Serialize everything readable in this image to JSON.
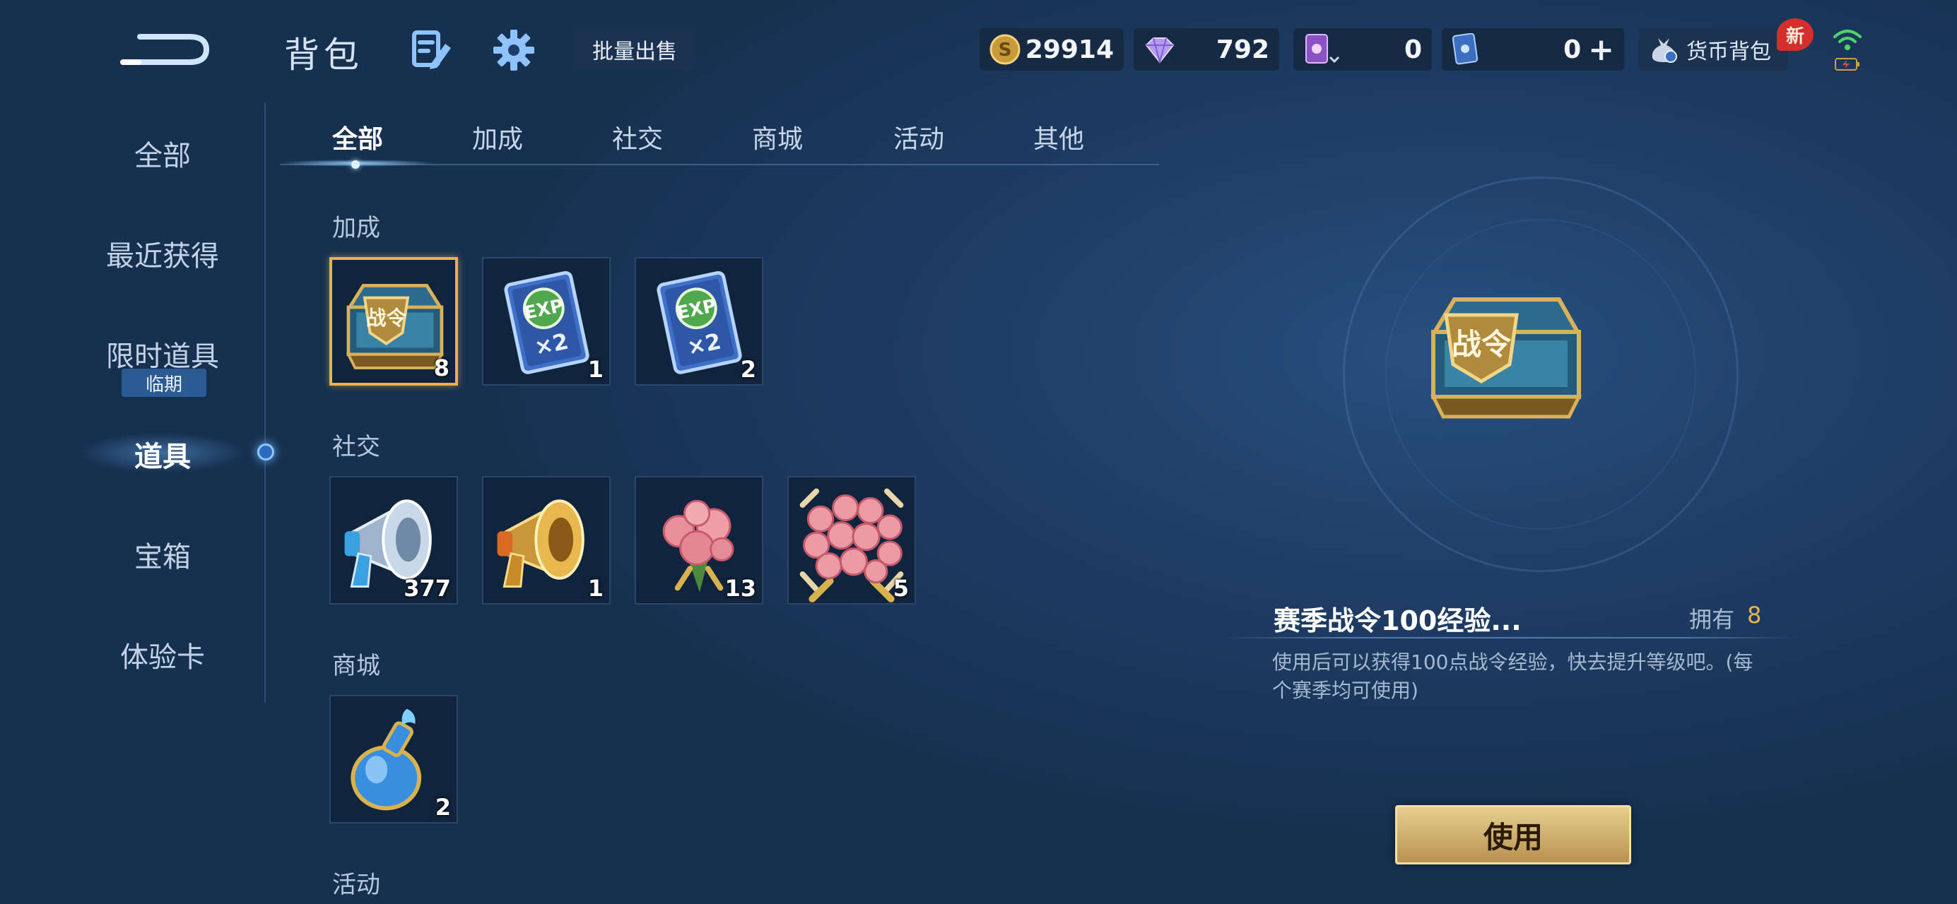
{
  "header": {
    "title": "背包",
    "bulk_sell_label": "批量出售",
    "wallet_label": "货币背包",
    "new_badge": "新"
  },
  "currencies": {
    "gold": "29914",
    "diamond": "792",
    "ticket": "0",
    "card": "0"
  },
  "sidebar": {
    "items": [
      {
        "label": "全部"
      },
      {
        "label": "最近获得"
      },
      {
        "label": "限时道具",
        "badge": "临期"
      },
      {
        "label": "道具",
        "active": true
      },
      {
        "label": "宝箱"
      },
      {
        "label": "体验卡"
      }
    ]
  },
  "tabs": [
    {
      "label": "全部",
      "active": true
    },
    {
      "label": "加成"
    },
    {
      "label": "社交"
    },
    {
      "label": "商城"
    },
    {
      "label": "活动"
    },
    {
      "label": "其他"
    }
  ],
  "sections": {
    "bonus": {
      "label": "加成",
      "items": [
        {
          "icon": "battle-pass-chest-icon",
          "badge": "战令",
          "count": "8",
          "selected": true
        },
        {
          "icon": "exp-card-icon",
          "text": "EXP",
          "mult": "×2",
          "count": "1"
        },
        {
          "icon": "exp-card-icon",
          "text": "EXP",
          "mult": "×2",
          "count": "2"
        }
      ]
    },
    "social": {
      "label": "社交",
      "items": [
        {
          "icon": "silver-megaphone-icon",
          "count": "377"
        },
        {
          "icon": "gold-megaphone-icon",
          "count": "1"
        },
        {
          "icon": "rose-bouquet-icon",
          "count": "13"
        },
        {
          "icon": "large-rose-bouquet-icon",
          "count": "5"
        }
      ]
    },
    "shop": {
      "label": "商城",
      "items": [
        {
          "icon": "potion-bottle-icon",
          "count": "2"
        }
      ]
    },
    "event": {
      "label": "活动"
    }
  },
  "detail": {
    "name": "赛季战令100经验...",
    "owned_label": "拥有",
    "owned_count": "8",
    "description": "使用后可以获得100点战令经验，快去提升等级吧。(每个赛季均可使用)",
    "use_label": "使用",
    "image_badge": "战令"
  },
  "colors": {
    "accent_gold": "#e8b24e",
    "selection_border": "#e5b24e",
    "background": "#1f3e67"
  }
}
